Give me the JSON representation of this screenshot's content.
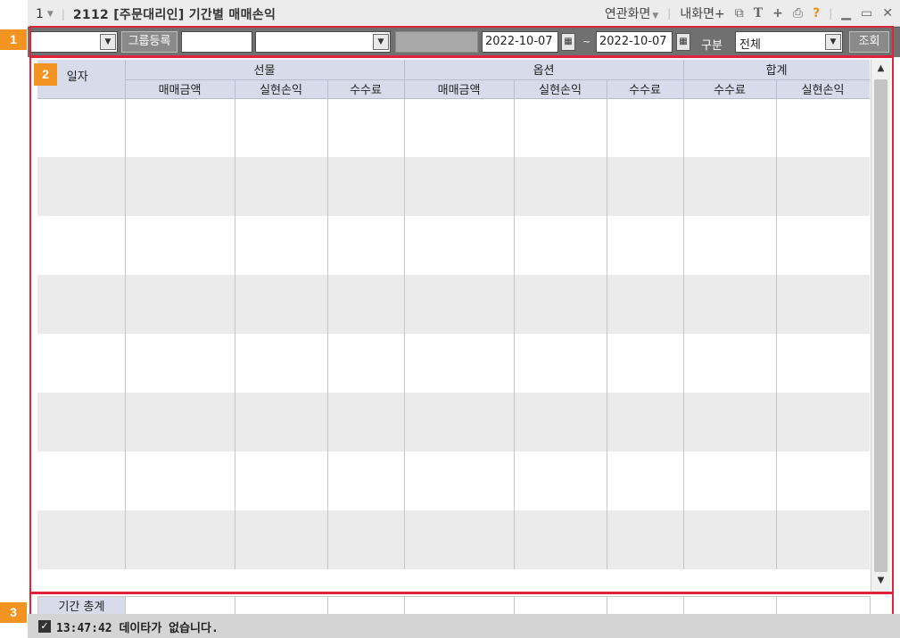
{
  "titlebar": {
    "screen_no": "1",
    "title": "2112 [주문대리인] 기간별 매매손익",
    "related_screens": "연관화면",
    "my_screen": "내화면"
  },
  "markers": [
    "1",
    "2",
    "3"
  ],
  "toolbar": {
    "group_register_label": "그룹등록",
    "date_from": "2022-10-07",
    "date_to": "2022-10-07",
    "date_sep": "~",
    "category_label": "구분",
    "category_value": "전체",
    "search_label": "조회"
  },
  "grid": {
    "date_header": "일자",
    "groups": [
      "선물",
      "옵션",
      "합계"
    ],
    "futures_columns": [
      "매매금액",
      "실현손익",
      "수수료"
    ],
    "options_columns": [
      "매매금액",
      "실현손익",
      "수수료"
    ],
    "total_columns": [
      "수수료",
      "실현손익"
    ]
  },
  "total_row": {
    "label": "기간 총계"
  },
  "status": {
    "time": "13:47:42",
    "message": "데이타가 없습니다."
  },
  "colors": {
    "accent": "#f29322",
    "highlight": "#e0233b",
    "header": "#d8dbea",
    "toolbar": "#707070"
  }
}
